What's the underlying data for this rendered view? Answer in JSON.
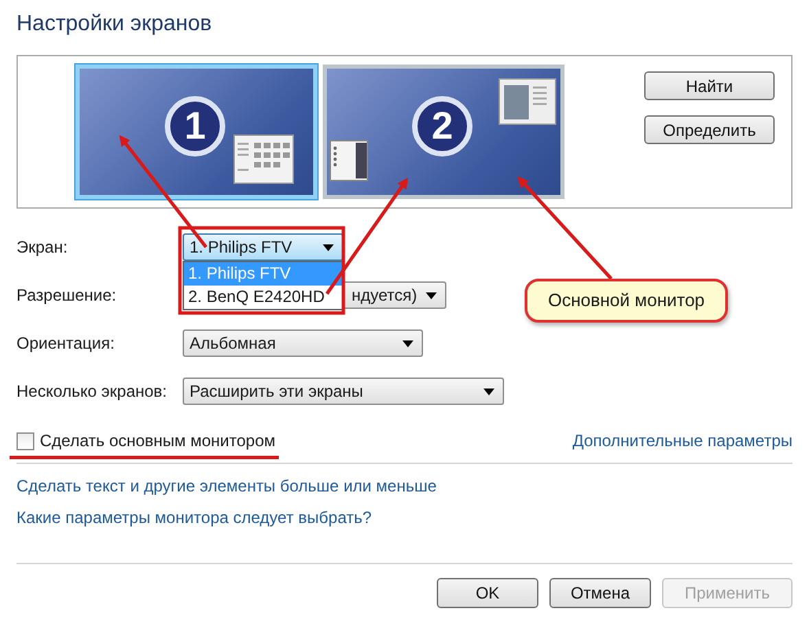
{
  "title": "Настройки экранов",
  "monitors": [
    {
      "number": "1",
      "selected": true
    },
    {
      "number": "2",
      "selected": false
    }
  ],
  "side_buttons": [
    "Найти",
    "Определить"
  ],
  "settings": [
    {
      "label": "Экран:",
      "value": "1. Philips FTV",
      "expanded": true,
      "options": [
        {
          "label": "1. Philips FTV",
          "selected": true
        },
        {
          "label": "2. BenQ E2420HD",
          "selected": false
        }
      ]
    },
    {
      "label": "Разрешение:",
      "value": "ндуется)",
      "expanded": false
    },
    {
      "label": "Ориентация:",
      "value": "Альбомная",
      "expanded": false
    },
    {
      "label": "Несколько экранов:",
      "value": "Расширить эти экраны",
      "expanded": false
    }
  ],
  "primary_checkbox": {
    "label": "Сделать основным монитором",
    "checked": false
  },
  "advanced_link": "Дополнительные параметры",
  "links": [
    "Сделать текст и другие элементы больше или меньше",
    "Какие параметры монитора следует выбрать?"
  ],
  "buttons": [
    {
      "label": "OK",
      "disabled": false
    },
    {
      "label": "Отмена",
      "disabled": false
    },
    {
      "label": "Применить",
      "disabled": true
    }
  ],
  "callout": "Основной монитор"
}
